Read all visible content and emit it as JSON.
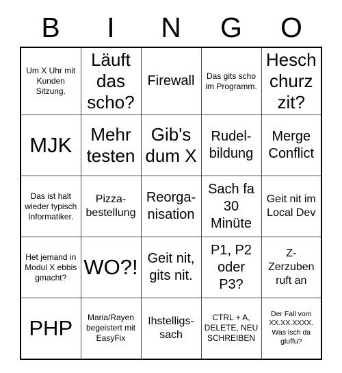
{
  "card": {
    "title_letters": [
      "B",
      "I",
      "N",
      "G",
      "O"
    ],
    "columns": 5,
    "rows": 5,
    "colors": {
      "background": "#ffffff",
      "text": "#000000",
      "grid_line": "#4d4d4d",
      "outer_border": "#000000"
    },
    "cells": [
      [
        {
          "text": "Um X Uhr mit Kunden Sitzung.",
          "size": "sz-s"
        },
        {
          "text": "Läuft das scho?",
          "size": "sz-xl"
        },
        {
          "text": "Firewall",
          "size": "sz-l"
        },
        {
          "text": "Das gits scho im Programm.",
          "size": "sz-s"
        },
        {
          "text": "Hesch churz zit?",
          "size": "sz-xl"
        }
      ],
      [
        {
          "text": "MJK",
          "size": "sz-xxl"
        },
        {
          "text": "Mehr testen",
          "size": "sz-xl"
        },
        {
          "text": "Gib's dum X",
          "size": "sz-xl"
        },
        {
          "text": "Rudel-bildung",
          "size": "sz-l"
        },
        {
          "text": "Merge Conflict",
          "size": "sz-l"
        }
      ],
      [
        {
          "text": "Das ist halt wieder typisch Informatiker.",
          "size": "sz-s"
        },
        {
          "text": "Pizza-bestellung",
          "size": "sz-m"
        },
        {
          "text": "Reorga-nisation",
          "size": "sz-l"
        },
        {
          "text": "Sach fa 30 Minüte",
          "size": "sz-l"
        },
        {
          "text": "Geit nit im Local Dev",
          "size": "sz-m"
        }
      ],
      [
        {
          "text": "Het jemand in Modul X ebbis gmacht?",
          "size": "sz-s"
        },
        {
          "text": "WO?!",
          "size": "sz-xxl"
        },
        {
          "text": "Geit nit, gits nit.",
          "size": "sz-l"
        },
        {
          "text": "P1, P2 oder P3?",
          "size": "sz-l"
        },
        {
          "text": "Z-Zerzuben ruft an",
          "size": "sz-m"
        }
      ],
      [
        {
          "text": "PHP",
          "size": "sz-xxl"
        },
        {
          "text": "Maria/Rayen begeistert mit EasyFix",
          "size": "sz-s"
        },
        {
          "text": "Ihstelligs-sach",
          "size": "sz-m"
        },
        {
          "text": "CTRL + A, DELETE, NEU SCHREIBEN",
          "size": "sz-s"
        },
        {
          "text": "Der Fall vom XX.XX.XXXX. Was isch da gluffu?",
          "size": "sz-xs"
        }
      ]
    ]
  }
}
